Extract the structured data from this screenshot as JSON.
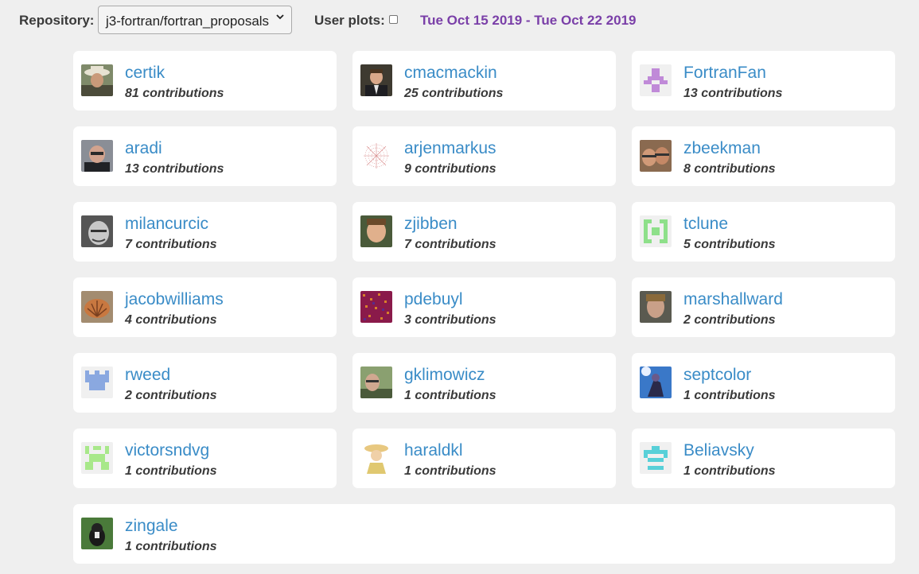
{
  "toolbar": {
    "repository_label": "Repository:",
    "repository_value": "j3-fortran/fortran_proposals",
    "user_plots_label": "User plots:",
    "user_plots_checked": false,
    "date_range": "Tue Oct 15 2019 - Tue Oct 22 2019"
  },
  "contributors": [
    {
      "name": "certik",
      "contributions": "81 contributions",
      "avatar": "photo-cowboy-hat"
    },
    {
      "name": "cmacmackin",
      "contributions": "25 contributions",
      "avatar": "photo-suit"
    },
    {
      "name": "FortranFan",
      "contributions": "13 contributions",
      "avatar": "identicon-purple"
    },
    {
      "name": "aradi",
      "contributions": "13 contributions",
      "avatar": "photo-glasses"
    },
    {
      "name": "arjenmarkus",
      "contributions": "9 contributions",
      "avatar": "pattern-red-dots"
    },
    {
      "name": "zbeekman",
      "contributions": "8 contributions",
      "avatar": "photo-two-faces"
    },
    {
      "name": "milancurcic",
      "contributions": "7 contributions",
      "avatar": "photo-bw-face"
    },
    {
      "name": "zjibben",
      "contributions": "7 contributions",
      "avatar": "photo-face"
    },
    {
      "name": "tclune",
      "contributions": "5 contributions",
      "avatar": "identicon-green"
    },
    {
      "name": "jacobwilliams",
      "contributions": "4 contributions",
      "avatar": "photo-shell"
    },
    {
      "name": "pdebuyl",
      "contributions": "3 contributions",
      "avatar": "pattern-noise-red"
    },
    {
      "name": "marshallward",
      "contributions": "2 contributions",
      "avatar": "photo-face-dark"
    },
    {
      "name": "rweed",
      "contributions": "2 contributions",
      "avatar": "identicon-blue"
    },
    {
      "name": "gklimowicz",
      "contributions": "1 contributions",
      "avatar": "photo-outdoor"
    },
    {
      "name": "septcolor",
      "contributions": "1 contributions",
      "avatar": "art-blue"
    },
    {
      "name": "victorsndvg",
      "contributions": "1 contributions",
      "avatar": "identicon-lightgreen"
    },
    {
      "name": "haraldkl",
      "contributions": "1 contributions",
      "avatar": "cartoon-hat"
    },
    {
      "name": "Beliavsky",
      "contributions": "1 contributions",
      "avatar": "identicon-cyan"
    },
    {
      "name": "zingale",
      "contributions": "1 contributions",
      "avatar": "photo-dog"
    }
  ],
  "colors": {
    "link": "#3a8cc7",
    "date": "#7a3fa8",
    "background": "#efefef"
  }
}
